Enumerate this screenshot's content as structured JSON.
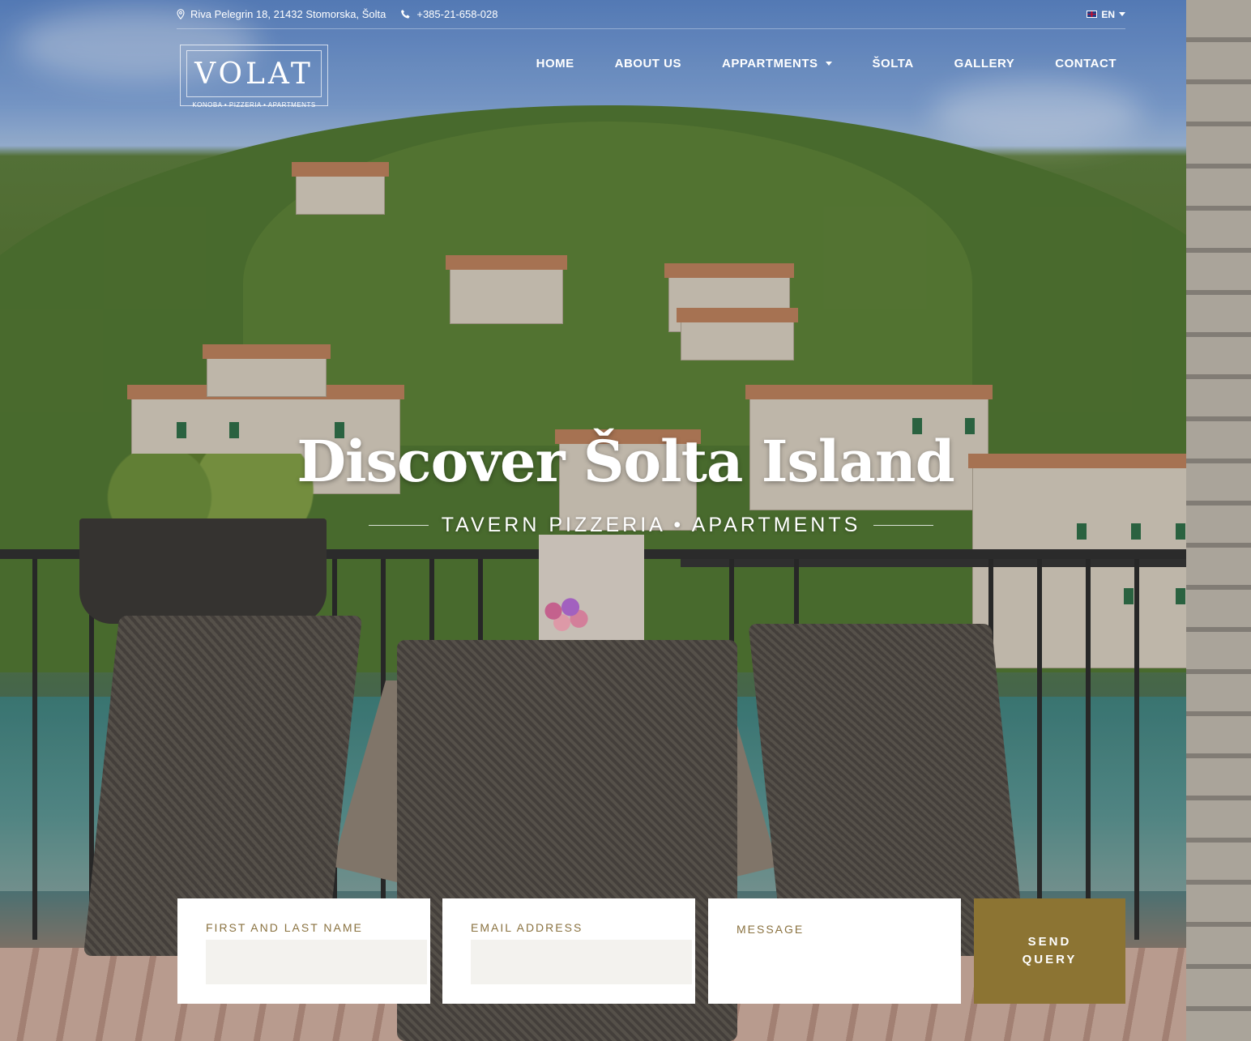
{
  "topbar": {
    "address": "Riva Pelegrin 18, 21432 Stomorska, Šolta",
    "phone": "+385-21-658-028",
    "language": "EN"
  },
  "logo": {
    "name": "VOLAT",
    "tagline": "KONOBA • PIZZERIA • APARTMENTS"
  },
  "nav": {
    "items": [
      {
        "label": "HOME"
      },
      {
        "label": "ABOUT US"
      },
      {
        "label": "APPARTMENTS",
        "has_dropdown": true
      },
      {
        "label": "ŠOLTA"
      },
      {
        "label": "GALLERY"
      },
      {
        "label": "CONTACT"
      }
    ]
  },
  "hero": {
    "title": "Discover Šolta Island",
    "subtitle": "TAVERN PIZZERIA • APARTMENTS"
  },
  "form": {
    "name_label": "FIRST AND LAST NAME",
    "email_label": "EMAIL ADDRESS",
    "message_label": "MESSAGE",
    "send_label_line1": "SEND",
    "send_label_line2": "QUERY"
  },
  "colors": {
    "accent": "#8c7433",
    "label": "#8a7240",
    "input_bg": "#f3f2ee"
  }
}
